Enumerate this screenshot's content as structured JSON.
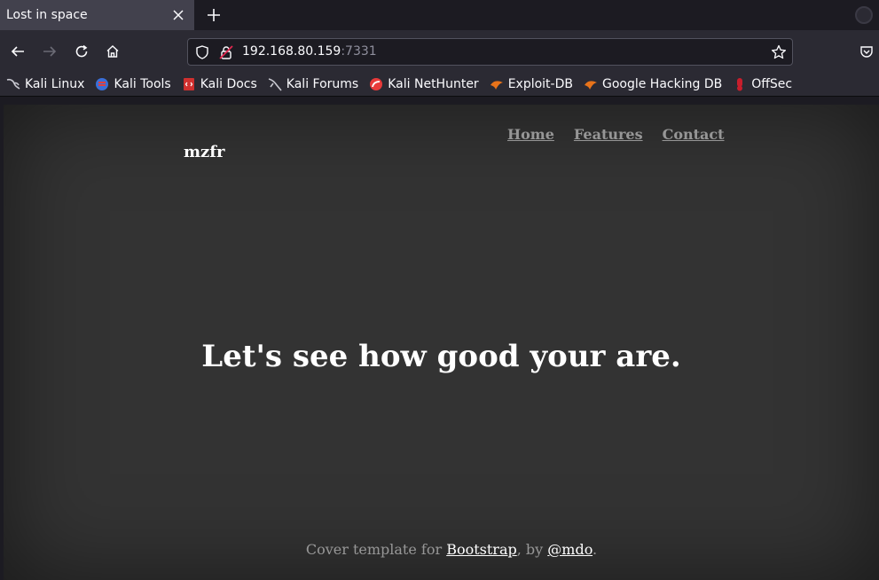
{
  "browser": {
    "tab": {
      "title": "Lost in space"
    },
    "url": {
      "host": "192.168.80.159",
      "port": ":7331"
    },
    "bookmarks": [
      {
        "label": "Kali Linux",
        "icon": "kali-dragon-icon"
      },
      {
        "label": "Kali Tools",
        "icon": "kali-tools-icon"
      },
      {
        "label": "Kali Docs",
        "icon": "kali-docs-icon"
      },
      {
        "label": "Kali Forums",
        "icon": "kali-forums-icon"
      },
      {
        "label": "Kali NetHunter",
        "icon": "nethunter-icon"
      },
      {
        "label": "Exploit-DB",
        "icon": "exploit-db-icon"
      },
      {
        "label": "Google Hacking DB",
        "icon": "ghdb-icon"
      },
      {
        "label": "OffSec",
        "icon": "offsec-icon"
      }
    ]
  },
  "site": {
    "brand": "mzfr",
    "nav": {
      "home": "Home",
      "features": "Features",
      "contact": "Contact"
    },
    "headline": "Let's see how good your are.",
    "footer": {
      "prefix": "Cover template for ",
      "link1": "Bootstrap",
      "middle": ", by ",
      "link2": "@mdo",
      "suffix": "."
    }
  },
  "colors": {
    "page_bg": "#333333",
    "toolbar_bg": "#2b2a33",
    "tabstrip_bg": "#1c1b22"
  }
}
